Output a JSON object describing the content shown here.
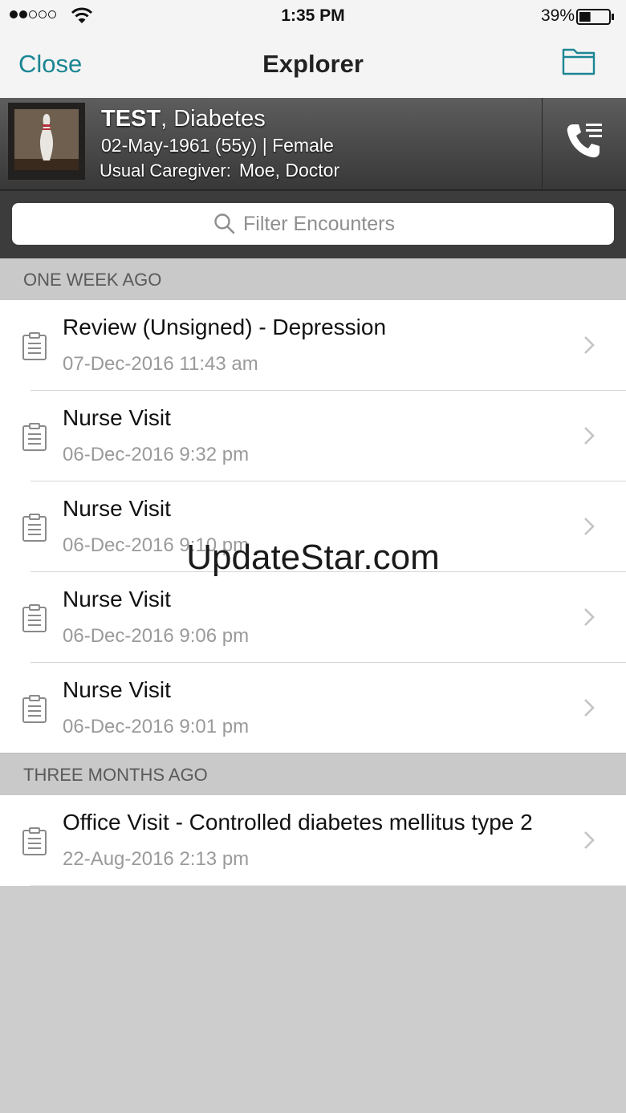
{
  "status_bar": {
    "time": "1:35 PM",
    "battery_percent": "39%",
    "battery_level": 0.39,
    "signal_bars": 2,
    "signal_total": 5
  },
  "nav": {
    "close_label": "Close",
    "title": "Explorer",
    "folder_icon": "folder-icon"
  },
  "patient": {
    "last_name": "TEST",
    "first_name": ", Diabetes",
    "dob_line": "02-May-1961 (55y) | Female",
    "caregiver_label": "Usual Caregiver:",
    "caregiver_name": "Moe, Doctor"
  },
  "search": {
    "placeholder": "Filter Encounters",
    "value": ""
  },
  "sections": [
    {
      "header": "ONE WEEK AGO",
      "items": [
        {
          "title": "Review (Unsigned) - Depression",
          "date": "07-Dec-2016 11:43 am"
        },
        {
          "title": "Nurse Visit",
          "date": "06-Dec-2016 9:32 pm"
        },
        {
          "title": "Nurse Visit",
          "date": "06-Dec-2016 9:10 pm"
        },
        {
          "title": "Nurse Visit",
          "date": "06-Dec-2016 9:06 pm"
        },
        {
          "title": "Nurse Visit",
          "date": "06-Dec-2016 9:01 pm"
        }
      ]
    },
    {
      "header": "THREE MONTHS AGO",
      "items": [
        {
          "title": "Office Visit - Controlled diabetes mellitus type 2",
          "date": "22-Aug-2016 2:13 pm"
        }
      ]
    }
  ],
  "watermark": "UpdateStar.com",
  "colors": {
    "accent": "#1b8593",
    "header_dark": "#3c3c3c",
    "section_bg": "#c9c9c9"
  }
}
